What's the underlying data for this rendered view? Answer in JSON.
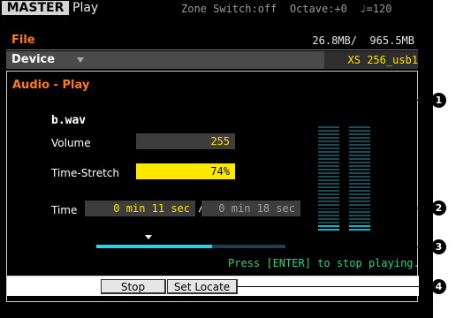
{
  "topbar": {
    "master_label": "MASTER",
    "mode_label": "Play",
    "status_text": "Zone Switch:off  Octave:+0  ♩=120"
  },
  "file_row": {
    "label": "File",
    "size": "26.8MB/  965.5MB"
  },
  "device_row": {
    "label": "Device",
    "value": "XS 256_usb1"
  },
  "panel": {
    "title": "Audio - Play",
    "filename": "b.wav",
    "volume_label": "Volume",
    "volume_value": "255",
    "time_stretch_label": "Time-Stretch",
    "time_stretch_value": "74%",
    "time_label": "Time",
    "time_current": "0 min 11 sec",
    "time_separator": "/",
    "time_total": "0 min 18 sec",
    "progress_fraction": 0.61,
    "meter_left_level": 0.08,
    "meter_right_level": 0.08,
    "hint": "Press [ENTER] to stop playing."
  },
  "softkeys": {
    "stop": "Stop",
    "set_locate": "Set Locate"
  },
  "callouts": [
    "1",
    "2",
    "3",
    "4"
  ],
  "colors": {
    "accent_orange": "#ff7a18",
    "value_yellow": "#ffe100",
    "highlight": "#ffe800",
    "meter_cyan": "#12b7c5",
    "hint_green": "#27d47a"
  }
}
